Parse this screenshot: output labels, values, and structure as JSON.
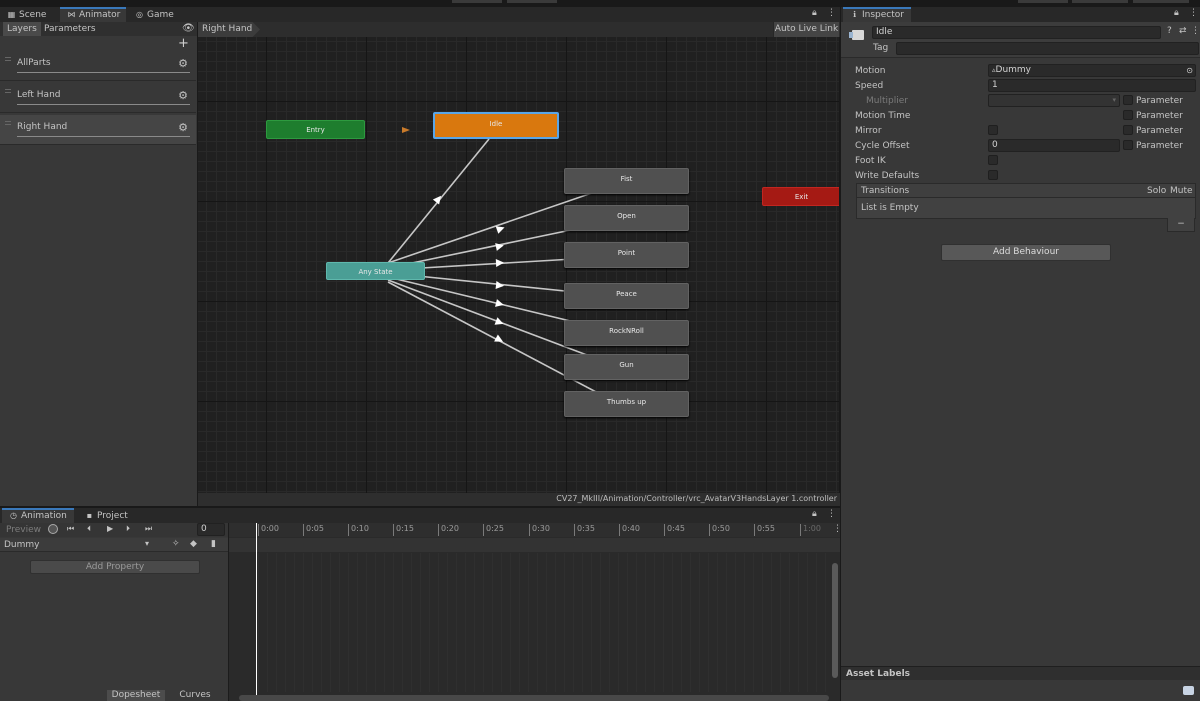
{
  "tabs": {
    "scene": "Scene",
    "animator": "Animator",
    "game": "Game",
    "inspector": "Inspector",
    "animation": "Animation",
    "project": "Project"
  },
  "animator": {
    "subtabs": {
      "layers": "Layers",
      "parameters": "Parameters"
    },
    "layers": [
      {
        "name": "AllParts"
      },
      {
        "name": "Left Hand"
      },
      {
        "name": "Right Hand"
      }
    ],
    "breadcrumb": "Right Hand",
    "auto_live_link": "Auto Live Link",
    "status_path": "CV27_MkIII/Animation/Controller/vrc_AvatarV3HandsLayer 1.controller",
    "nodes": {
      "entry": "Entry",
      "idle": "Idle",
      "any_state": "Any State",
      "exit": "Exit",
      "fist": "Fist",
      "open": "Open",
      "point": "Point",
      "peace": "Peace",
      "rocknroll": "RockNRoll",
      "gun": "Gun",
      "thumbsup": "Thumbs up"
    }
  },
  "inspector": {
    "name_value": "Idle",
    "tag_label": "Tag",
    "fields": {
      "motion_label": "Motion",
      "motion_value": "Dummy",
      "speed_label": "Speed",
      "speed_value": "1",
      "multiplier_label": "Multiplier",
      "motion_time_label": "Motion Time",
      "mirror_label": "Mirror",
      "cycle_offset_label": "Cycle Offset",
      "cycle_offset_value": "0",
      "foot_ik_label": "Foot IK",
      "write_defaults_label": "Write Defaults",
      "parameter_label": "Parameter"
    },
    "transitions": {
      "header": "Transitions",
      "solo": "Solo",
      "mute": "Mute",
      "empty": "List is Empty",
      "minus": "−"
    },
    "add_behaviour": "Add Behaviour",
    "asset_labels": "Asset Labels"
  },
  "animation": {
    "preview": "Preview",
    "frame_value": "0",
    "clip": "Dummy",
    "add_property": "Add Property",
    "dopesheet": "Dopesheet",
    "curves": "Curves",
    "ticks": [
      "0:00",
      "0:05",
      "0:10",
      "0:15",
      "0:20",
      "0:25",
      "0:30",
      "0:35",
      "0:40",
      "0:45",
      "0:50",
      "0:55",
      "1:00"
    ]
  },
  "colors": {
    "entry": "#1e7d2e",
    "idle": "#d9780e",
    "any_state": "#4a9e95",
    "exit": "#a51a14",
    "selection": "#3a79bb"
  },
  "icons": {
    "scene": "grid-icon",
    "animator": "animator-icon",
    "game": "gamepad-icon",
    "inspector": "info-icon",
    "gear": "gear-icon",
    "plus": "plus-icon",
    "eye": "eye-icon",
    "lock": "lock-icon",
    "menu": "kebab-menu-icon"
  }
}
